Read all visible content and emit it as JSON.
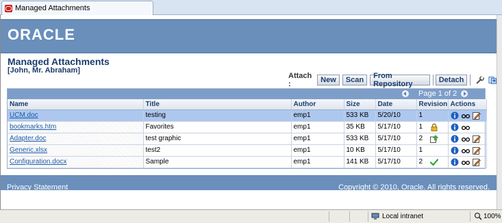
{
  "browser": {
    "tab_title": "Managed Attachments"
  },
  "brand": {
    "logo_text": "ORACLE",
    "bar_color": "#6a8fbb"
  },
  "page": {
    "title": "Managed Attachments",
    "subtitle": "[John, Mr. Abraham]"
  },
  "toolbar": {
    "attach_label": "Attach :",
    "buttons": [
      "New",
      "Scan",
      "From Repository",
      "Detach"
    ],
    "icons": [
      "wrench-icon",
      "refresh-icon"
    ]
  },
  "pager": {
    "text": "Page 1 of 2"
  },
  "table": {
    "columns": [
      "Name",
      "Title",
      "Author",
      "Size",
      "Date",
      "Revision",
      "Actions"
    ],
    "rows": [
      {
        "name": "UCM.doc",
        "title": "testing",
        "author": "emp1",
        "size": "533 KB",
        "date": "5/20/10",
        "revision": "1",
        "status_icon": "",
        "actions": [
          "info-icon",
          "view-icon",
          "edit-icon"
        ],
        "selected": true
      },
      {
        "name": "bookmarks.htm",
        "title": "Favorites",
        "author": "emp1",
        "size": "35 KB",
        "date": "5/17/10",
        "revision": "1",
        "status_icon": "lock-icon",
        "actions": [
          "info-icon",
          "view-icon"
        ],
        "selected": false
      },
      {
        "name": "Adapter.doc",
        "title": "test graphic",
        "author": "emp1",
        "size": "533 KB",
        "date": "5/17/10",
        "revision": "2",
        "status_icon": "checkout-icon",
        "actions": [
          "info-icon",
          "view-icon",
          "edit-icon"
        ],
        "selected": false
      },
      {
        "name": "Generic.xlsx",
        "title": "test2",
        "author": "emp1",
        "size": "10 KB",
        "date": "5/17/10",
        "revision": "1",
        "status_icon": "",
        "actions": [
          "info-icon",
          "view-icon",
          "edit-icon"
        ],
        "selected": false
      },
      {
        "name": "Configuration.docx",
        "title": "Sample",
        "author": "emp1",
        "size": "141 KB",
        "date": "5/17/10",
        "revision": "2",
        "status_icon": "checkmark-icon",
        "actions": [
          "info-icon",
          "view-icon",
          "edit-icon"
        ],
        "selected": false
      }
    ]
  },
  "footer": {
    "privacy": "Privacy Statement",
    "copyright": "Copyright © 2010, Oracle. All rights reserved."
  },
  "statusbar": {
    "zone": "Local intranet",
    "zoom": "100%"
  }
}
